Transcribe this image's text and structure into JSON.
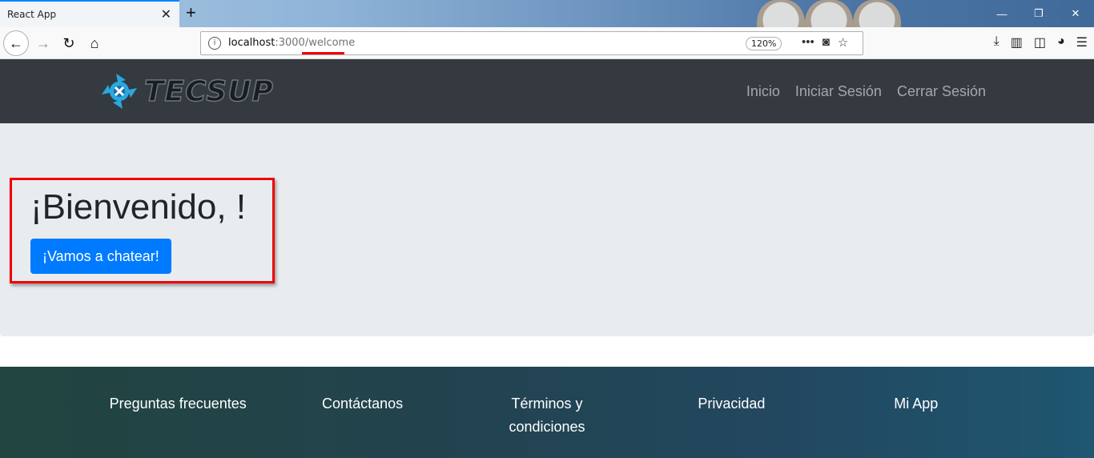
{
  "browser": {
    "tab_title": "React App",
    "tab_close": "✕",
    "new_tab": "+",
    "url_host": "localhost",
    "url_rest": ":3000/welcome",
    "zoom": "120%",
    "window_controls": [
      "—",
      "❐",
      "✕"
    ]
  },
  "navbar": {
    "logo_text": "TECSUP",
    "links": [
      "Inicio",
      "Iniciar Sesión",
      "Cerrar Sesión"
    ]
  },
  "jumbotron": {
    "title": "¡Bienvenido, !",
    "button_label": "¡Vamos a chatear!"
  },
  "footer": {
    "links": [
      "Preguntas frecuentes",
      "Contáctanos",
      "Términos y condiciones",
      "Privacidad",
      "Mi App"
    ]
  },
  "colors": {
    "navbar_bg": "#343a40",
    "jumbotron_bg": "#e9ecef",
    "primary": "#007bff",
    "highlight": "#ee0000"
  }
}
